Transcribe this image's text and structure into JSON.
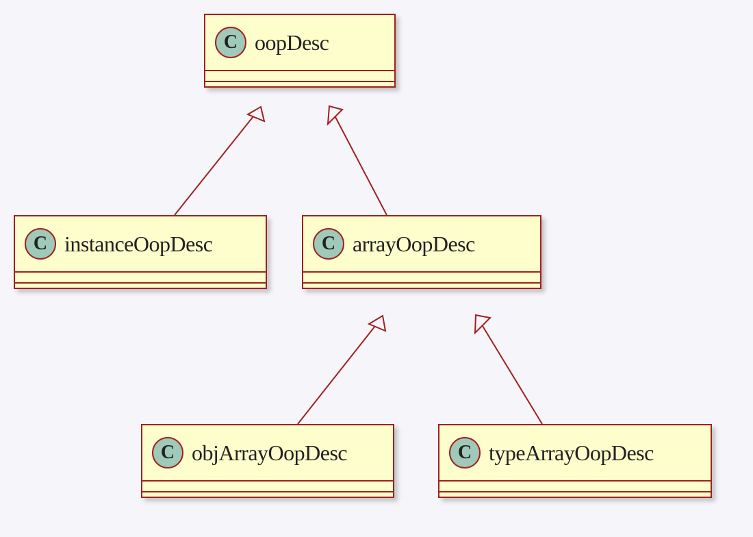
{
  "diagram": {
    "type": "uml-class-hierarchy",
    "stereotype_letter": "C",
    "classes": {
      "oopDesc": {
        "name": "oopDesc",
        "parent": null
      },
      "instanceOopDesc": {
        "name": "instanceOopDesc",
        "parent": "oopDesc"
      },
      "arrayOopDesc": {
        "name": "arrayOopDesc",
        "parent": "oopDesc"
      },
      "objArrayOopDesc": {
        "name": "objArrayOopDesc",
        "parent": "arrayOopDesc"
      },
      "typeArrayOopDesc": {
        "name": "typeArrayOopDesc",
        "parent": "arrayOopDesc"
      }
    },
    "colors": {
      "box_fill": "#fefecc",
      "border": "#a02020",
      "circle_fill": "#9fc9b8",
      "background": "#f5f5fa"
    }
  }
}
